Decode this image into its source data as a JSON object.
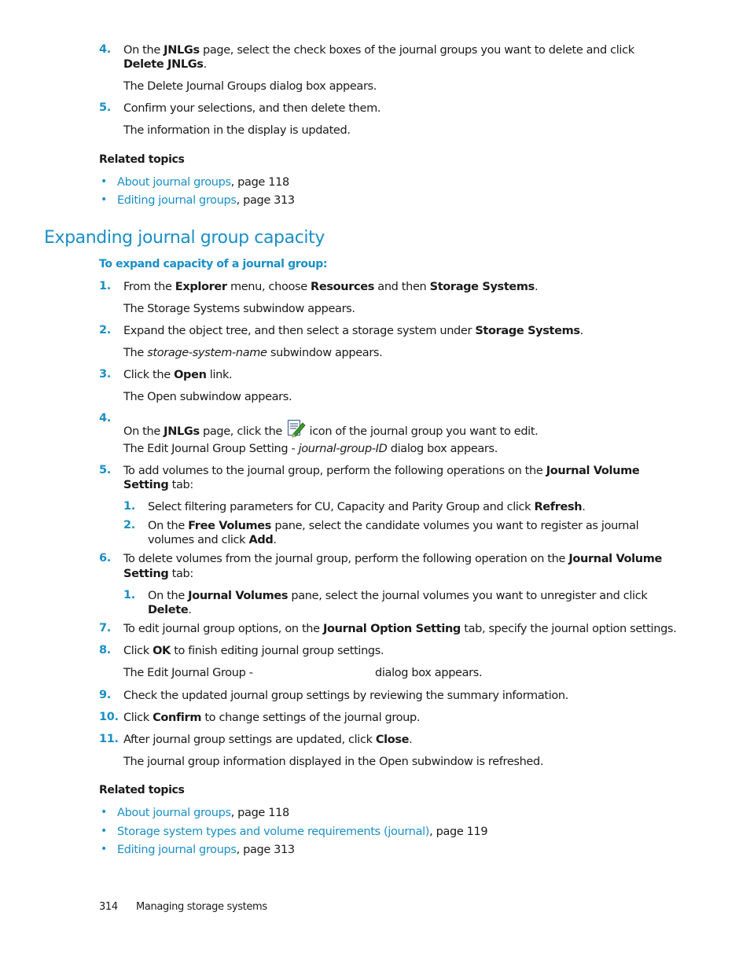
{
  "top_steps": [
    {
      "num": "4.",
      "parts": [
        "On the ",
        "JNLGs",
        " page, select the check boxes of the journal groups you want to delete and click"
      ],
      "line2_bold": "Delete JNLGs",
      "line2_rest": ".",
      "result": "The Delete Journal Groups dialog box appears."
    },
    {
      "num": "5.",
      "text": "Confirm your selections, and then delete them.",
      "result": "The information in the display is updated."
    }
  ],
  "related_topics_1": {
    "heading": "Related topics",
    "items": [
      {
        "link": "About journal groups",
        "suffix": ", page 118"
      },
      {
        "link": "Editing journal groups",
        "suffix": ", page 313"
      }
    ]
  },
  "section": {
    "title": "Expanding journal group capacity",
    "procedure_title": "To expand capacity of a journal group:"
  },
  "steps": {
    "s1": {
      "num": "1.",
      "a": "From the ",
      "b1": "Explorer",
      "c": " menu, choose ",
      "b2": "Resources",
      "d": " and then ",
      "b3": "Storage Systems",
      "e": ".",
      "result": "The Storage Systems subwindow appears."
    },
    "s2": {
      "num": "2.",
      "a": "Expand the object tree, and then select a storage system under ",
      "b1": "Storage Systems",
      "e": ".",
      "result_a": "The ",
      "result_i": "storage-system-name",
      "result_b": " subwindow appears."
    },
    "s3": {
      "num": "3.",
      "a": "Click the ",
      "b1": "Open",
      "e": " link.",
      "result": "The Open subwindow appears."
    },
    "s4": {
      "num": "4.",
      "a": "On the ",
      "b1": "JNLGs",
      "c": " page, click the ",
      "icon": "edit-icon",
      "e": " icon of the journal group you want to edit.",
      "result_a": "The Edit Journal Group Setting - ",
      "result_i": "journal-group-ID",
      "result_b": " dialog box appears."
    },
    "s5": {
      "num": "5.",
      "a": "To add volumes to the journal group, perform the following operations on the ",
      "b1": "Journal Volume",
      "b2": "Setting",
      "e": " tab:",
      "sub": [
        {
          "num": "1.",
          "a": "Select filtering parameters for CU, Capacity and Parity Group and click ",
          "b1": "Refresh",
          "e": "."
        },
        {
          "num": "2.",
          "a": "On the ",
          "b1": "Free Volumes",
          "c": " pane, select the candidate volumes you want to register as journal",
          "d": "volumes and click ",
          "b2": "Add",
          "e": "."
        }
      ]
    },
    "s6": {
      "num": "6.",
      "a": "To delete volumes from the journal group, perform the following operation on the ",
      "b1": "Journal Volume",
      "b2": "Setting",
      "e": " tab:",
      "sub": [
        {
          "num": "1.",
          "a": "On the ",
          "b1": "Journal Volumes",
          "c": " pane, select the journal volumes you want to unregister and click",
          "b2": "Delete",
          "e": "."
        }
      ]
    },
    "s7": {
      "num": "7.",
      "a": "To edit journal group options, on the ",
      "b1": "Journal Option Setting",
      "e": " tab, specify the journal option settings."
    },
    "s8": {
      "num": "8.",
      "a": "Click ",
      "b1": "OK",
      "e": " to finish editing journal group settings.",
      "result_a": "The Edit Journal Group -",
      "result_b": "dialog box appears."
    },
    "s9": {
      "num": "9.",
      "a": "Check the updated journal group settings by reviewing the summary information."
    },
    "s10": {
      "num": "10.",
      "a": "Click ",
      "b1": "Confirm",
      "e": " to change settings of the journal group."
    },
    "s11": {
      "num": "11.",
      "a": "After journal group settings are updated, click ",
      "b1": "Close",
      "e": ".",
      "result": "The journal group information displayed in the Open subwindow is refreshed."
    }
  },
  "related_topics_2": {
    "heading": "Related topics",
    "items": [
      {
        "link": "About journal groups",
        "suffix": ", page 118"
      },
      {
        "link": "Storage system types and volume requirements (journal)",
        "suffix": ", page 119"
      },
      {
        "link": "Editing journal groups",
        "suffix": ", page 313"
      }
    ]
  },
  "footer": {
    "page_number": "314",
    "chapter": "Managing storage systems"
  },
  "colors": {
    "accent": "#1a8fc6",
    "text": "#1a1a1a"
  }
}
